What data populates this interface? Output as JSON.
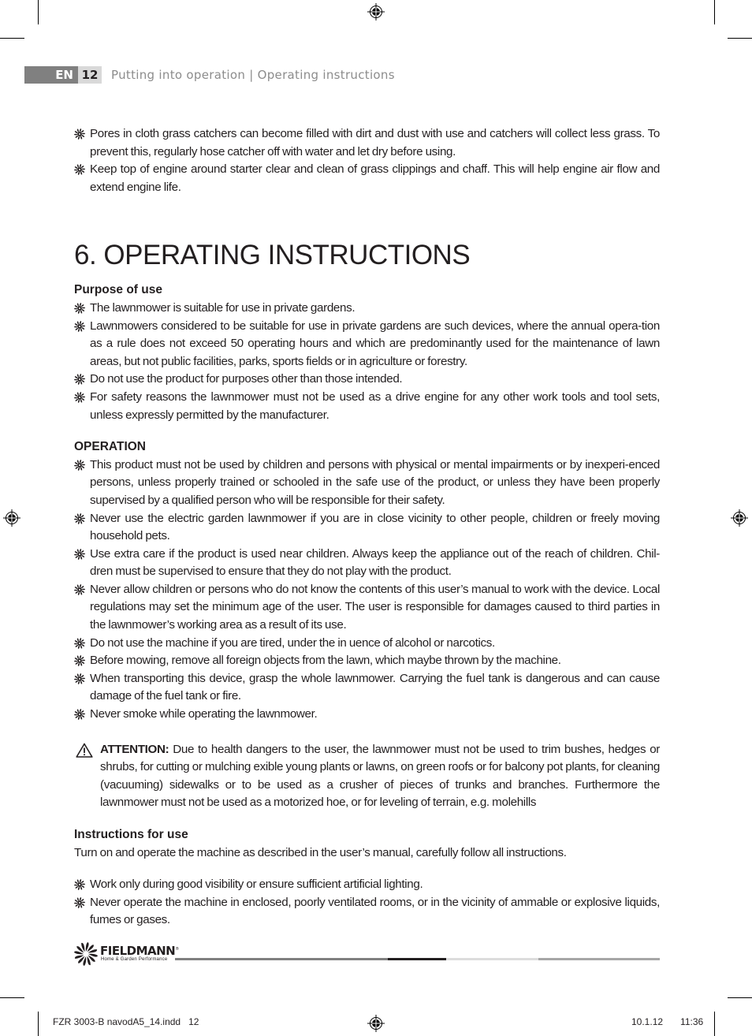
{
  "header": {
    "language": "EN",
    "page_number": "12",
    "section_title": "Putting into operation | Operating instructions"
  },
  "intro_bullets": [
    "Pores in cloth grass catchers can become filled with dirt and dust with use and catchers will collect less grass. To prevent this, regularly hose catcher off with water and let dry before using.",
    "Keep top of engine around starter clear and clean of grass clippings and chaff. This will help engine air flow and extend engine life."
  ],
  "chapter_title": "6. OPERATING INSTRUCTIONS",
  "sections": {
    "purpose": {
      "heading": "Purpose of use",
      "bullets": [
        "The lawnmower is suitable for use in private gardens.",
        "Lawnmowers considered to be suitable for use in private gardens are such devices, where the annual opera-tion as a rule does not exceed 50 operating hours and which are predominantly used for the maintenance of lawn areas, but not public facilities, parks, sports fields or in agriculture or forestry.",
        "Do not use the product for purposes other than those intended.",
        "For safety reasons the lawnmower must not be used as a drive engine for any other work tools and tool sets, unless expressly permitted by the manufacturer."
      ]
    },
    "operation": {
      "heading": "OPERATION",
      "bullets": [
        "This product must not be used by children and persons with physical or mental impairments or by inexperi-enced persons, unless properly trained or schooled in the safe use of the product, or unless they have been properly supervised by a qualified person who will be responsible for their safety.",
        "Never use the electric garden lawnmower if you are in close vicinity to other people, children or freely moving household pets.",
        "Use extra care if the product is used near children. Always keep the appliance out of the reach of children. Chil-dren must be supervised to ensure that they do not play with the product.",
        "Never allow children or persons who do not know the contents of this user’s manual to work with the device. Local regulations may set the minimum age of the user. The user is responsible for damages caused to third parties in the lawnmower’s working area as a result of its use.",
        "Do not use the machine if you are tired, under the in uence of alcohol or narcotics.",
        "Before mowing, remove all foreign objects from the lawn, which maybe thrown by the machine.",
        "When transporting this device, grasp the whole lawnmower. Carrying the fuel tank is dangerous and can cause damage of the fuel tank or fire.",
        "Never smoke while operating the lawnmower."
      ]
    },
    "attention": {
      "icon": "warning-triangle-icon",
      "label": "ATTENTION:",
      "text": "Due to health dangers to the user, the lawnmower must not be used to trim bushes, hedges or shrubs, for cutting or mulching  exible young plants or lawns, on green roofs or for balcony pot plants, for cleaning (vacuuming) sidewalks or to be used as a crusher of pieces of trunks and branches. Furthermore the lawnmower must not be used as a motorized hoe, or for leveling of terrain, e.g. molehills"
    },
    "instructions": {
      "heading": "Instructions for use",
      "intro": "Turn on and operate the machine as described in the user’s manual, carefully follow all instructions.",
      "bullets": [
        "Work only during good visibility or ensure sufficient artificial lighting.",
        "Never operate the machine in enclosed, poorly ventilated rooms, or in the vicinity of  ammable or explosive liquids, fumes or gases."
      ]
    }
  },
  "footer": {
    "brand": "FIELDMANN",
    "brand_mark": "®",
    "tagline": "Home & Garden Performance",
    "bar_colors": [
      "#808080",
      "#231f20",
      "#dcdcdc",
      "#a6a6a6"
    ],
    "slug_file": "FZR 3003-B navodA5_14.indd   12",
    "slug_date": "10.1.12   11:36"
  },
  "icons": {
    "bullet": "fan-blade-bullet-icon",
    "registration": "registration-mark-icon"
  }
}
